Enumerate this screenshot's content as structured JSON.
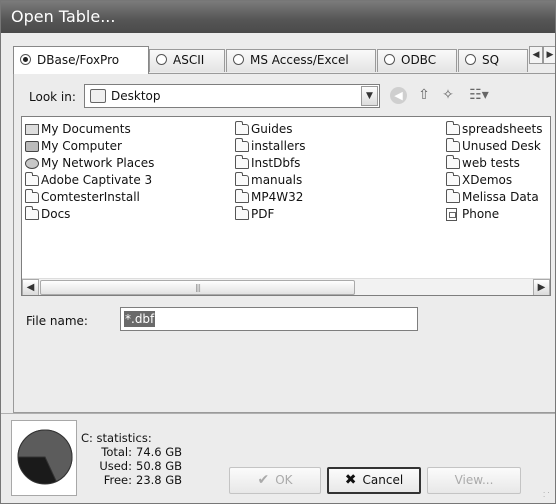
{
  "window": {
    "title": "Open Table..."
  },
  "tabs": [
    {
      "label": "DBase/FoxPro",
      "selected": true
    },
    {
      "label": "ASCII",
      "selected": false
    },
    {
      "label": "MS Access/Excel",
      "selected": false
    },
    {
      "label": "ODBC",
      "selected": false
    },
    {
      "label": "SQ",
      "selected": false
    }
  ],
  "look_in": {
    "label": "Look in:",
    "value": "Desktop"
  },
  "files": {
    "col1": [
      {
        "name": "My Documents",
        "icon": "documents-icon"
      },
      {
        "name": "My Computer",
        "icon": "computer-icon"
      },
      {
        "name": "My Network Places",
        "icon": "network-icon"
      },
      {
        "name": "Adobe Captivate 3",
        "icon": "folder-icon"
      },
      {
        "name": "ComtesterInstall",
        "icon": "folder-icon"
      },
      {
        "name": "Docs",
        "icon": "folder-icon"
      }
    ],
    "col2": [
      {
        "name": "Guides",
        "icon": "folder-icon"
      },
      {
        "name": "installers",
        "icon": "folder-icon"
      },
      {
        "name": "InstDbfs",
        "icon": "folder-icon"
      },
      {
        "name": "manuals",
        "icon": "folder-icon"
      },
      {
        "name": "MP4W32",
        "icon": "folder-icon"
      },
      {
        "name": "PDF",
        "icon": "folder-icon"
      }
    ],
    "col3": [
      {
        "name": "spreadsheets",
        "icon": "folder-icon"
      },
      {
        "name": "Unused Desk",
        "icon": "folder-icon"
      },
      {
        "name": "web tests",
        "icon": "folder-icon"
      },
      {
        "name": "XDemos",
        "icon": "folder-icon"
      },
      {
        "name": "Melissa Data",
        "icon": "folder-icon"
      },
      {
        "name": "Phone",
        "icon": "file-icon"
      }
    ]
  },
  "file_name": {
    "label": "File name:",
    "value": "*.dbf"
  },
  "stats": {
    "header": "C: statistics:",
    "total_label": "Total:",
    "total_value": "74.6 GB",
    "used_label": "Used:",
    "used_value": "50.8 GB",
    "free_label": "Free:",
    "free_value": "23.8 GB",
    "used_fraction": 0.681
  },
  "buttons": {
    "ok": "OK",
    "cancel": "Cancel",
    "view": "View..."
  },
  "colors": {
    "title_bar": "#5a5a5a",
    "disk_used": "#5c5c5c",
    "disk_free": "#1a1a1a"
  }
}
